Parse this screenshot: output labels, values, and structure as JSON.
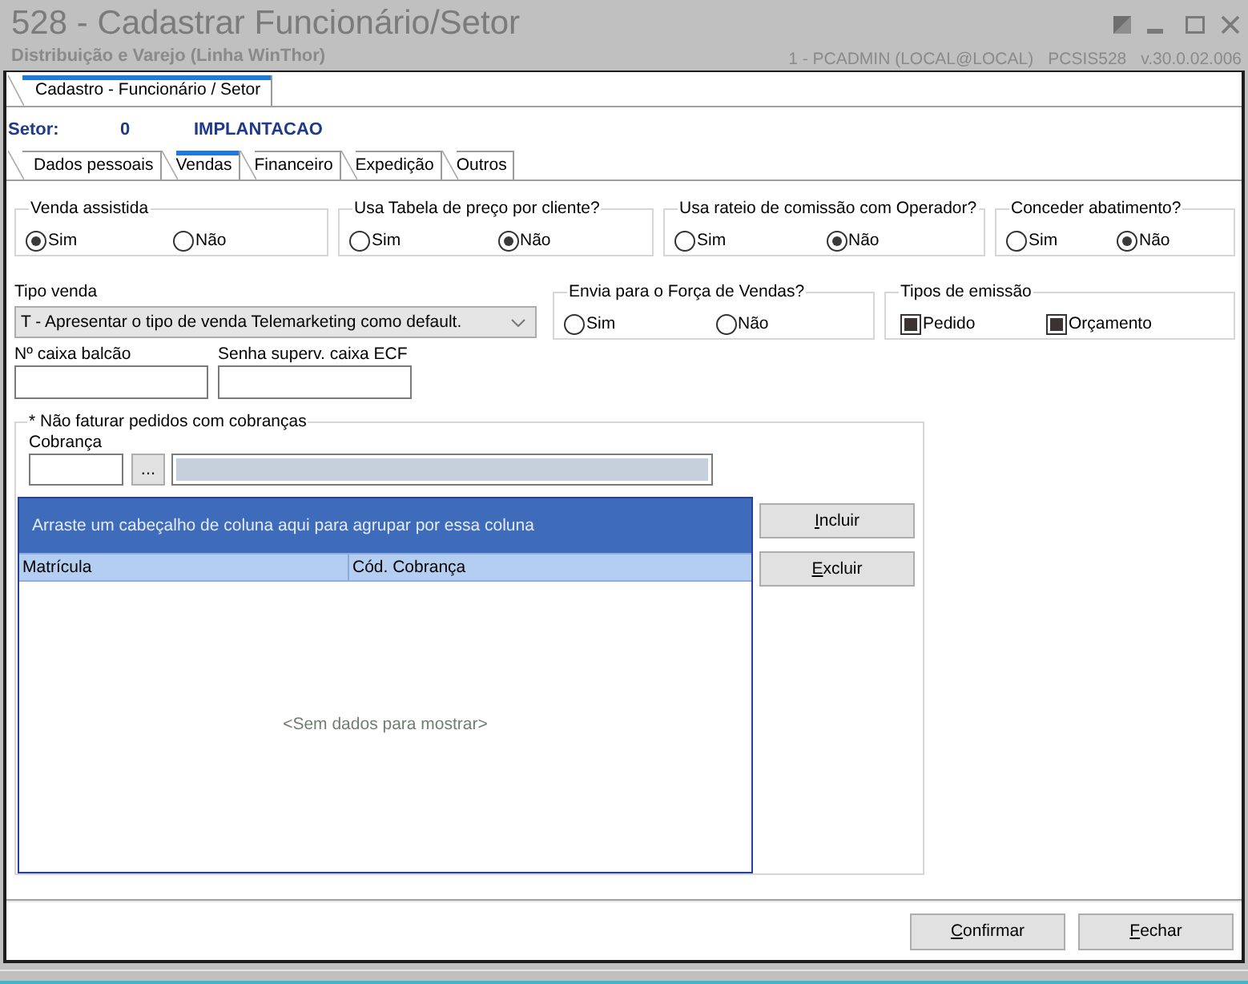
{
  "window": {
    "title": "528 - Cadastrar Funcionário/Setor",
    "subtitle": "Distribuição e Varejo (Linha WinThor)",
    "user": "1 - PCADMIN (LOCAL@LOCAL)",
    "program": "PCSIS528",
    "version": "v.30.0.02.006"
  },
  "form_tabs": [
    {
      "label": "Cadastro - Funcionário / Setor",
      "selected": true
    }
  ],
  "setor": {
    "label": "Setor:",
    "code": "0",
    "name": "IMPLANTACAO"
  },
  "tabs": [
    {
      "label": "Dados pessoais",
      "selected": false
    },
    {
      "label": "Vendas",
      "selected": true
    },
    {
      "label": "Financeiro",
      "selected": false
    },
    {
      "label": "Expedição",
      "selected": false
    },
    {
      "label": "Outros",
      "selected": false
    }
  ],
  "option_groups": [
    {
      "title": "Venda assistida",
      "options": [
        {
          "label": "Sim",
          "selected": true
        },
        {
          "label": "Não",
          "selected": false
        }
      ]
    },
    {
      "title": "Usa Tabela de preço por cliente?",
      "options": [
        {
          "label": "Sim",
          "selected": false
        },
        {
          "label": "Não",
          "selected": true
        }
      ]
    },
    {
      "title": "Usa rateio de comissão com Operador?",
      "options": [
        {
          "label": "Sim",
          "selected": false
        },
        {
          "label": "Não",
          "selected": true
        }
      ]
    },
    {
      "title": "Conceder abatimento?",
      "options": [
        {
          "label": "Sim",
          "selected": false
        },
        {
          "label": "Não",
          "selected": true
        }
      ]
    }
  ],
  "sale_type": {
    "label": "Tipo venda",
    "value": "T - Apresentar o tipo de venda Telemarketing como default."
  },
  "sales_force": {
    "title": "Envia para o Força de Vendas?",
    "options": [
      {
        "label": "Sim",
        "selected": false
      },
      {
        "label": "Não",
        "selected": false
      }
    ]
  },
  "emission_types": {
    "title": "Tipos de emissão",
    "options": [
      {
        "label": "Pedido",
        "checked": true
      },
      {
        "label": "Orçamento",
        "checked": true
      }
    ]
  },
  "fields": [
    {
      "label": "Nº caixa balcão"
    },
    {
      "label": "Senha superv. caixa ECF"
    }
  ],
  "billing_block": {
    "title": "* Não faturar pedidos com cobranças",
    "lookup_label": "Cobrança",
    "browse_button": "...",
    "grid": {
      "group_panel_hint": "Arraste um cabeçalho de coluna aqui para agrupar por essa coluna",
      "columns": [
        "Matrícula",
        "Cód. Cobrança"
      ],
      "empty_text": "<Sem dados para mostrar>"
    },
    "buttons": [
      "Incluir",
      "Excluir"
    ]
  },
  "footer_buttons": [
    "Confirmar",
    "Fechar"
  ]
}
